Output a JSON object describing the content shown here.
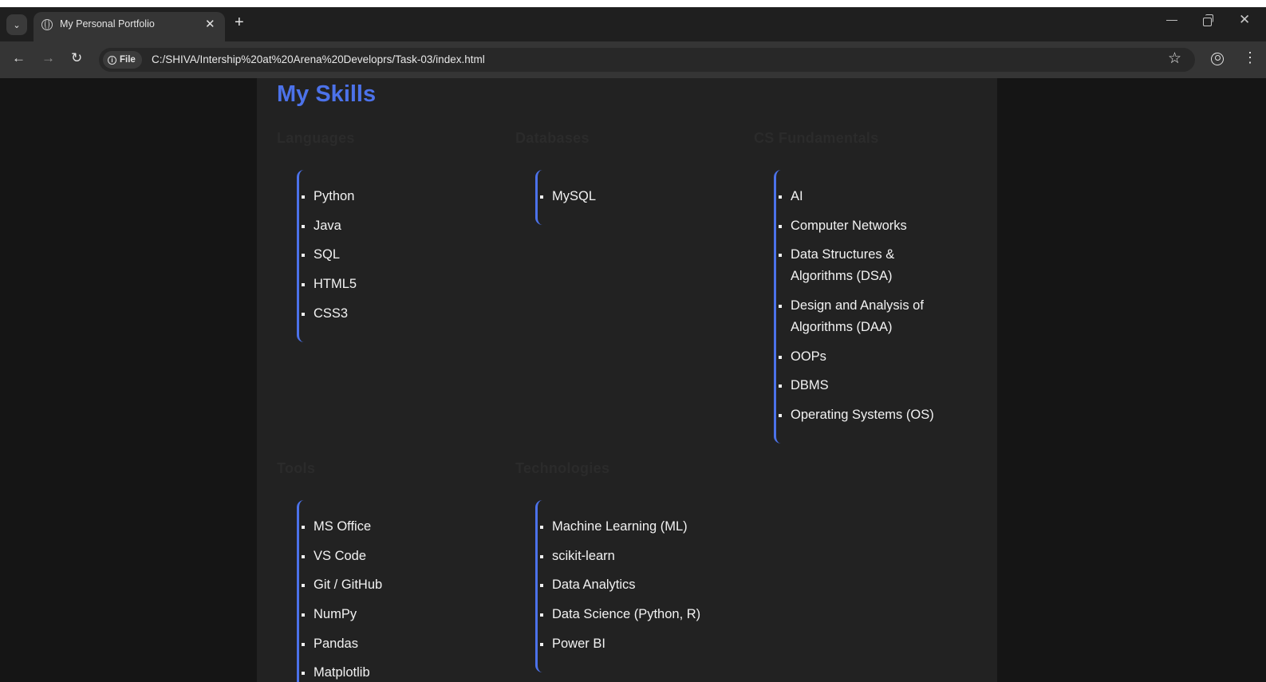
{
  "browser": {
    "tab_title": "My Personal Portfolio",
    "new_tab_symbol": "+",
    "chip_label": "File",
    "url": "C:/SHIVA/Intership%20at%20Arena%20Developrs/Task-03/index.html"
  },
  "page": {
    "section_title": "My Skills",
    "groups": [
      {
        "title": "Languages",
        "items": [
          "Python",
          "Java",
          "SQL",
          "HTML5",
          "CSS3"
        ]
      },
      {
        "title": "Databases",
        "items": [
          "MySQL"
        ]
      },
      {
        "title": "CS Fundamentals",
        "items": [
          "AI",
          "Computer Networks",
          "Data Structures & Algorithms (DSA)",
          "Design and Analysis of Algorithms (DAA)",
          "OOPs",
          "DBMS",
          "Operating Systems (OS)"
        ]
      },
      {
        "title": "Tools",
        "items": [
          "MS Office",
          "VS Code",
          "Git / GitHub",
          "NumPy",
          "Pandas",
          "Matplotlib"
        ]
      },
      {
        "title": "Technologies",
        "items": [
          "Machine Learning (ML)",
          "scikit-learn",
          "Data Analytics",
          "Data Science (Python, R)",
          "Power BI"
        ]
      }
    ]
  },
  "colors": {
    "accent": "#4c72ea",
    "panel": "#222222",
    "page_bg": "#151515"
  }
}
